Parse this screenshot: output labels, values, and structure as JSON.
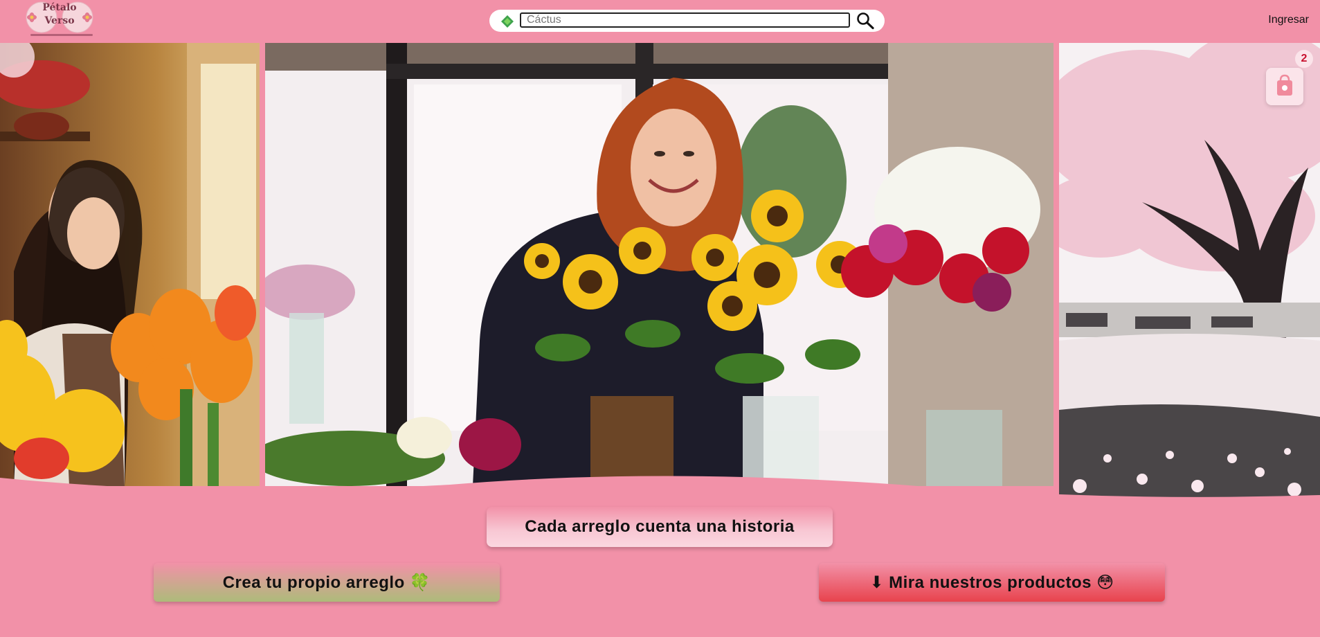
{
  "brand": {
    "name_line1": "Pétalo",
    "name_line2": "Verso"
  },
  "search": {
    "placeholder": "Cáctus",
    "value": ""
  },
  "header": {
    "login_label": "Ingresar"
  },
  "cart": {
    "count": "2"
  },
  "hero": {
    "tagline": "Cada arreglo cuenta una historia"
  },
  "actions": {
    "create_label": "Crea tu propio arreglo",
    "create_emoji": "🍀",
    "products_arrow": "⬇",
    "products_label": "Mira nuestros productos",
    "products_emoji": "😳"
  },
  "colors": {
    "background": "#f291a8",
    "create_gradient_end": "#adbb7a",
    "products_gradient_end": "#e8434d",
    "badge_text": "#c8102e"
  }
}
